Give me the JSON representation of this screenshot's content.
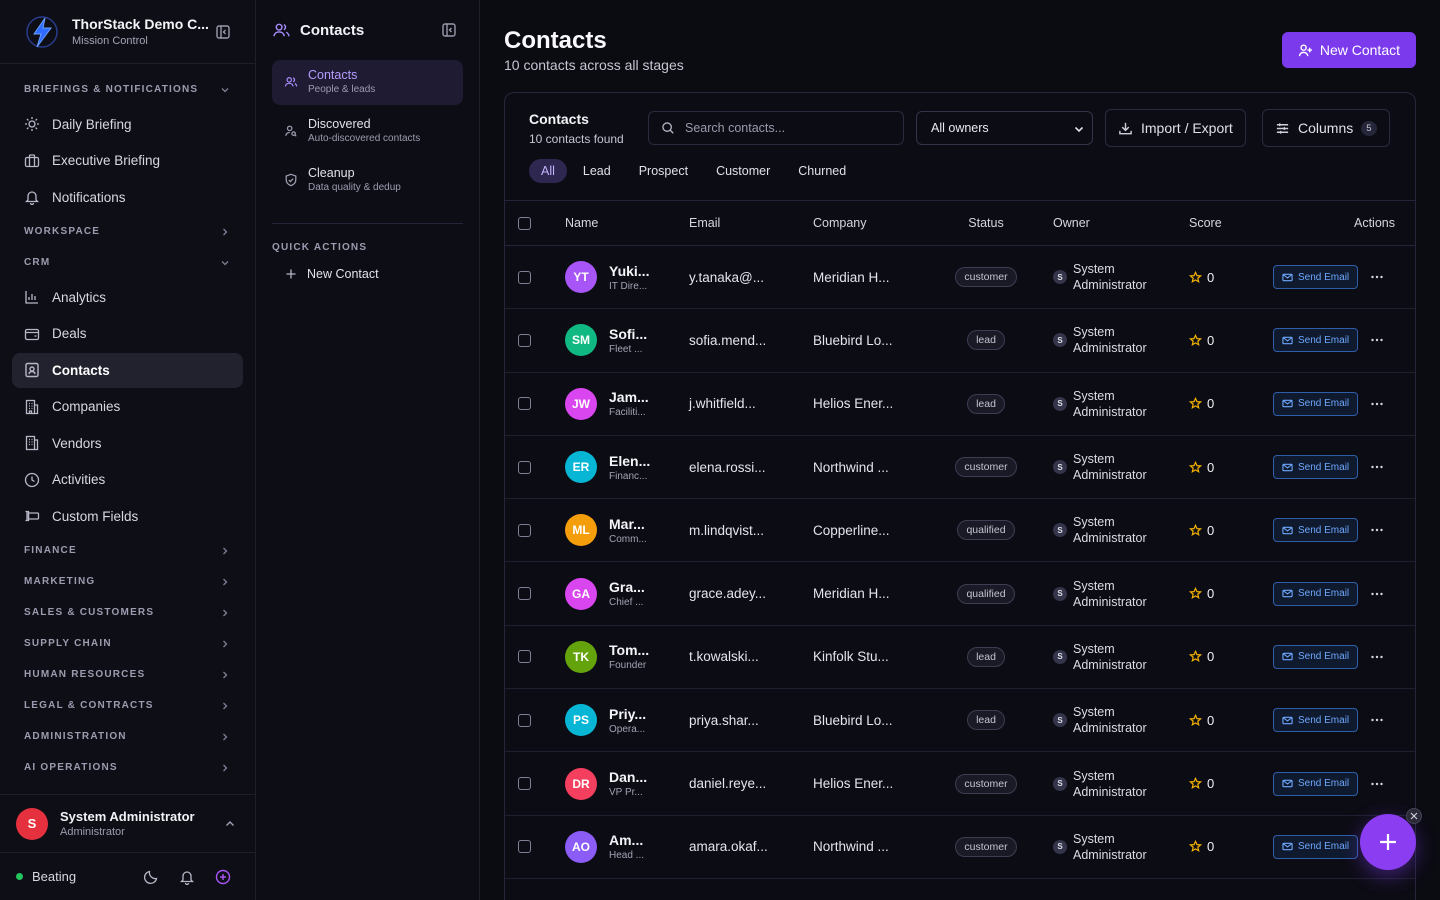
{
  "brand": {
    "title": "ThorStack Demo C...",
    "subtitle": "Mission Control"
  },
  "sidebar": {
    "sections": [
      {
        "label": "BRIEFINGS & NOTIFICATIONS",
        "expanded": true
      },
      {
        "label": "WORKSPACE",
        "expanded": false
      },
      {
        "label": "CRM",
        "expanded": true
      },
      {
        "label": "FINANCE",
        "expanded": false
      },
      {
        "label": "MARKETING",
        "expanded": false
      },
      {
        "label": "SALES & CUSTOMERS",
        "expanded": false
      },
      {
        "label": "SUPPLY CHAIN",
        "expanded": false
      },
      {
        "label": "HUMAN RESOURCES",
        "expanded": false
      },
      {
        "label": "LEGAL & CONTRACTS",
        "expanded": false
      },
      {
        "label": "ADMINISTRATION",
        "expanded": false
      },
      {
        "label": "AI OPERATIONS",
        "expanded": false
      }
    ],
    "briefing_items": [
      {
        "label": "Daily Briefing",
        "icon": "sun-icon"
      },
      {
        "label": "Executive Briefing",
        "icon": "briefcase-icon"
      },
      {
        "label": "Notifications",
        "icon": "bell-icon"
      }
    ],
    "crm_items": [
      {
        "label": "Analytics",
        "icon": "bar-chart-icon"
      },
      {
        "label": "Deals",
        "icon": "wallet-icon"
      },
      {
        "label": "Contacts",
        "icon": "contact-card-icon",
        "active": true
      },
      {
        "label": "Companies",
        "icon": "building-icon"
      },
      {
        "label": "Vendors",
        "icon": "store-icon"
      },
      {
        "label": "Activities",
        "icon": "clock-icon"
      },
      {
        "label": "Custom Fields",
        "icon": "custom-field-icon"
      }
    ]
  },
  "user": {
    "initial": "S",
    "name": "System Administrator",
    "role": "Administrator"
  },
  "status": {
    "label": "Beating"
  },
  "subnav": {
    "title": "Contacts",
    "items": [
      {
        "label": "Contacts",
        "desc": "People & leads",
        "active": true
      },
      {
        "label": "Discovered",
        "desc": "Auto-discovered contacts"
      },
      {
        "label": "Cleanup",
        "desc": "Data quality & dedup"
      }
    ],
    "quick_actions_label": "QUICK ACTIONS",
    "quick_actions": [
      {
        "label": "New Contact"
      }
    ]
  },
  "main": {
    "title": "Contacts",
    "subtitle": "10 contacts across all stages",
    "new_button": "New Contact",
    "card_title": "Contacts",
    "card_sub": "10 contacts found",
    "search_placeholder": "Search contacts...",
    "owner_filter": "All owners",
    "import_export": "Import / Export",
    "columns": {
      "label": "Columns",
      "count": "5"
    },
    "filters": [
      "All",
      "Lead",
      "Prospect",
      "Customer",
      "Churned"
    ],
    "active_filter": "All"
  },
  "table": {
    "headers": {
      "name": "Name",
      "email": "Email",
      "company": "Company",
      "status": "Status",
      "owner": "Owner",
      "score": "Score",
      "actions": "Actions"
    },
    "send_email_label": "Send Email",
    "rows": [
      {
        "initials": "YT",
        "color": "#a855f7",
        "name": "Yuki...",
        "title": "IT Dire...",
        "email": "y.tanaka@...",
        "company": "Meridian H...",
        "status": "customer",
        "owner_initial": "S",
        "owner_line1": "System",
        "owner_line2": "Administrator",
        "score": "0"
      },
      {
        "initials": "SM",
        "color": "#10b981",
        "name": "Sofi...",
        "title": "Fleet ...",
        "email": "sofia.mend...",
        "company": "Bluebird Lo...",
        "status": "lead",
        "owner_initial": "S",
        "owner_line1": "System",
        "owner_line2": "Administrator",
        "score": "0"
      },
      {
        "initials": "JW",
        "color": "#d946ef",
        "name": "Jam...",
        "title": "Faciliti...",
        "email": "j.whitfield...",
        "company": "Helios Ener...",
        "status": "lead",
        "owner_initial": "S",
        "owner_line1": "System",
        "owner_line2": "Administrator",
        "score": "0"
      },
      {
        "initials": "ER",
        "color": "#06b6d4",
        "name": "Elen...",
        "title": "Financ...",
        "email": "elena.rossi...",
        "company": "Northwind ...",
        "status": "customer",
        "owner_initial": "S",
        "owner_line1": "System",
        "owner_line2": "Administrator",
        "score": "0"
      },
      {
        "initials": "ML",
        "color": "#f59e0b",
        "name": "Mar...",
        "title": "Comm...",
        "email": "m.lindqvist...",
        "company": "Copperline...",
        "status": "qualified",
        "owner_initial": "S",
        "owner_line1": "System",
        "owner_line2": "Administrator",
        "score": "0"
      },
      {
        "initials": "GA",
        "color": "#d946ef",
        "name": "Gra...",
        "title": "Chief ...",
        "email": "grace.adey...",
        "company": "Meridian H...",
        "status": "qualified",
        "owner_initial": "S",
        "owner_line1": "System",
        "owner_line2": "Administrator",
        "score": "0"
      },
      {
        "initials": "TK",
        "color": "#65a30d",
        "name": "Tom...",
        "title": "Founder",
        "email": "t.kowalski...",
        "company": "Kinfolk Stu...",
        "status": "lead",
        "owner_initial": "S",
        "owner_line1": "System",
        "owner_line2": "Administrator",
        "score": "0"
      },
      {
        "initials": "PS",
        "color": "#06b6d4",
        "name": "Priy...",
        "title": "Opera...",
        "email": "priya.shar...",
        "company": "Bluebird Lo...",
        "status": "lead",
        "owner_initial": "S",
        "owner_line1": "System",
        "owner_line2": "Administrator",
        "score": "0"
      },
      {
        "initials": "DR",
        "color": "#f43f5e",
        "name": "Dan...",
        "title": "VP Pr...",
        "email": "daniel.reye...",
        "company": "Helios Ener...",
        "status": "customer",
        "owner_initial": "S",
        "owner_line1": "System",
        "owner_line2": "Administrator",
        "score": "0"
      },
      {
        "initials": "AO",
        "color": "#8b5cf6",
        "name": "Am...",
        "title": "Head ...",
        "email": "amara.okaf...",
        "company": "Northwind ...",
        "status": "customer",
        "owner_initial": "S",
        "owner_line1": "System",
        "owner_line2": "Administrator",
        "score": "0"
      }
    ]
  }
}
